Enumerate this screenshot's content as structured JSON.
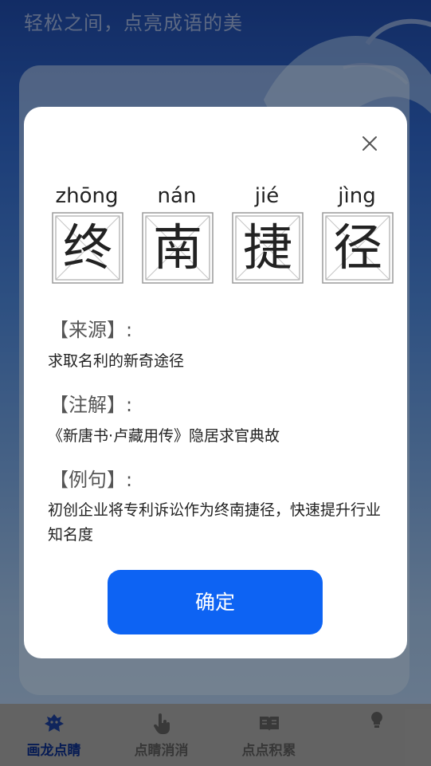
{
  "background": {
    "banner_text": "轻松之间，点亮成语的美"
  },
  "modal": {
    "idiom": [
      {
        "pinyin": "zhōng",
        "char": "终"
      },
      {
        "pinyin": "nán",
        "char": "南"
      },
      {
        "pinyin": "jié",
        "char": "捷"
      },
      {
        "pinyin": "jìng",
        "char": "径"
      }
    ],
    "source_title": "【来源】:",
    "source_text": "求取名利的新奇途径",
    "note_title": "【注解】:",
    "note_text": "《新唐书·卢藏用传》隐居求官典故",
    "example_title": "【例句】:",
    "example_text": "初创企业将专利诉讼作为终南捷径，快速提升行业知名度",
    "confirm_label": "确定",
    "close_icon": "close-icon"
  },
  "bottom_nav": {
    "items": [
      {
        "label": "画龙点睛",
        "icon": "dragon-icon",
        "active": true
      },
      {
        "label": "点睛消消",
        "icon": "pointer-hand-icon",
        "active": false
      },
      {
        "label": "点点积累",
        "icon": "book-icon",
        "active": false
      },
      {
        "label": "",
        "icon": "lightbulb-icon",
        "active": false
      }
    ]
  },
  "colors": {
    "accent": "#0d63f3",
    "nav_active": "#0a2d8a"
  }
}
